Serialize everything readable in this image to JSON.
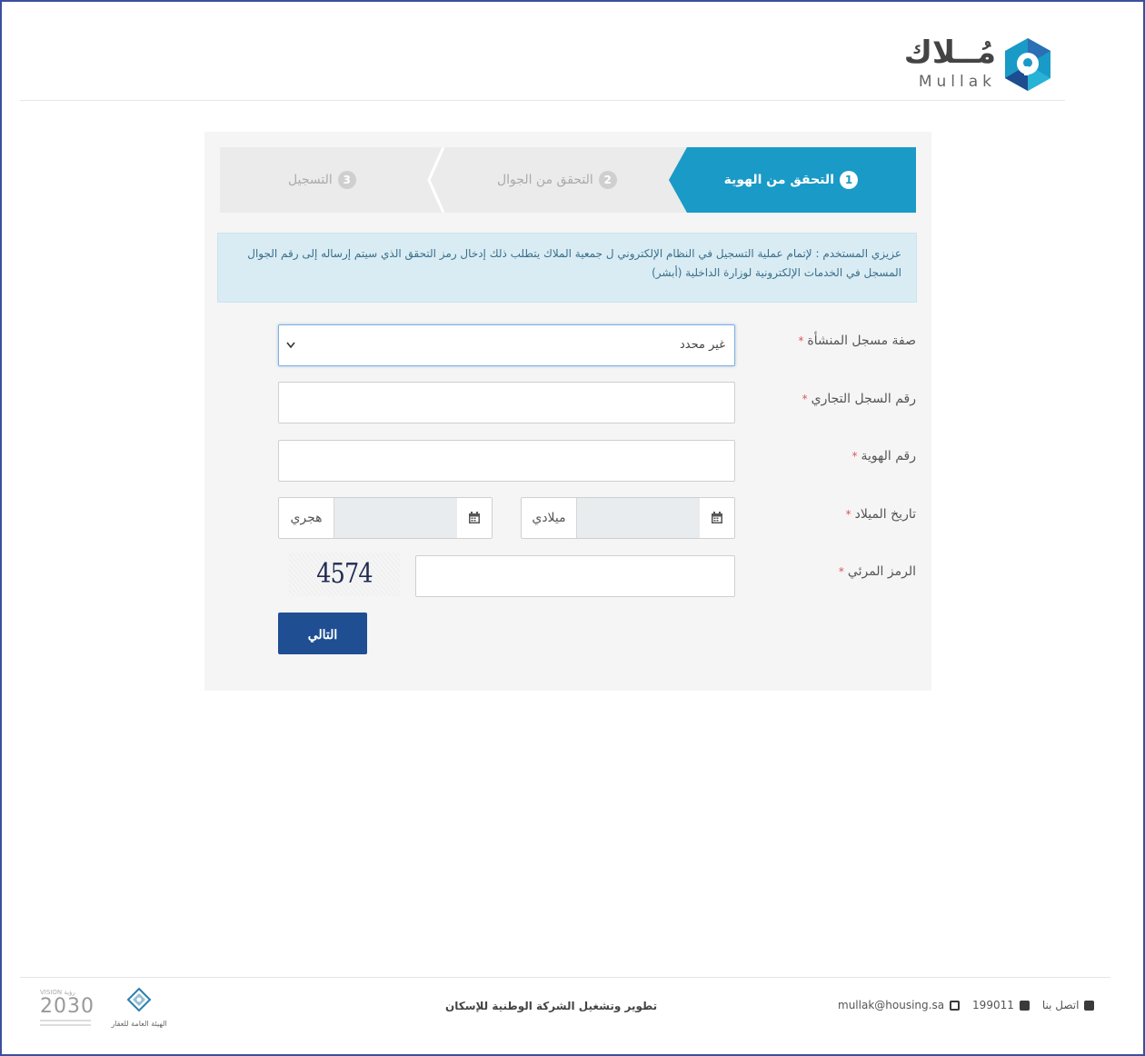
{
  "logo": {
    "arabic": "مُــلاك",
    "english": "Mullak"
  },
  "steps": [
    {
      "number": "1",
      "label": "التحقق من الهوية",
      "state": "active"
    },
    {
      "number": "2",
      "label": "التحقق من الجوال",
      "state": "inactive"
    },
    {
      "number": "3",
      "label": "التسجيل",
      "state": "inactive"
    }
  ],
  "info_message": "عزيزي المستخدم : لإتمام عملية التسجيل في النظام الإلكتروني ل جمعية الملاك يتطلب ذلك إدخال رمز التحقق الذي سيتم إرساله إلى رقم الجوال المسجل في الخدمات الإلكترونية لوزارة الداخلية (أبشر)",
  "form": {
    "required_mark": "*",
    "registrant_type": {
      "label": "صفة مسجل المنشأة",
      "value": "غير محدد"
    },
    "commercial_register": {
      "label": "رقم السجل التجاري",
      "value": ""
    },
    "id_number": {
      "label": "رقم الهوية",
      "value": ""
    },
    "birth_date": {
      "label": "تاريخ الميلاد",
      "gregorian_suffix": "ميلادي",
      "hijri_suffix": "هجري"
    },
    "captcha": {
      "label": "الرمز المرئي",
      "code": "4574",
      "value": ""
    },
    "next_button": "التالي"
  },
  "footer": {
    "contact_label": "اتصل بنا",
    "phone": "199011",
    "email": "mullak@housing.sa",
    "developer": "تطوير وتشغيل الشركة الوطنية للإسكان",
    "vision_text": "2030",
    "vision_small": "VISION رؤية",
    "authority_name": "الهيئة العامة للعقار"
  },
  "colors": {
    "active_step": "#1a9ac6",
    "primary_button": "#1f4e92",
    "info_bg": "#d9ecf4",
    "required": "#e05555"
  }
}
